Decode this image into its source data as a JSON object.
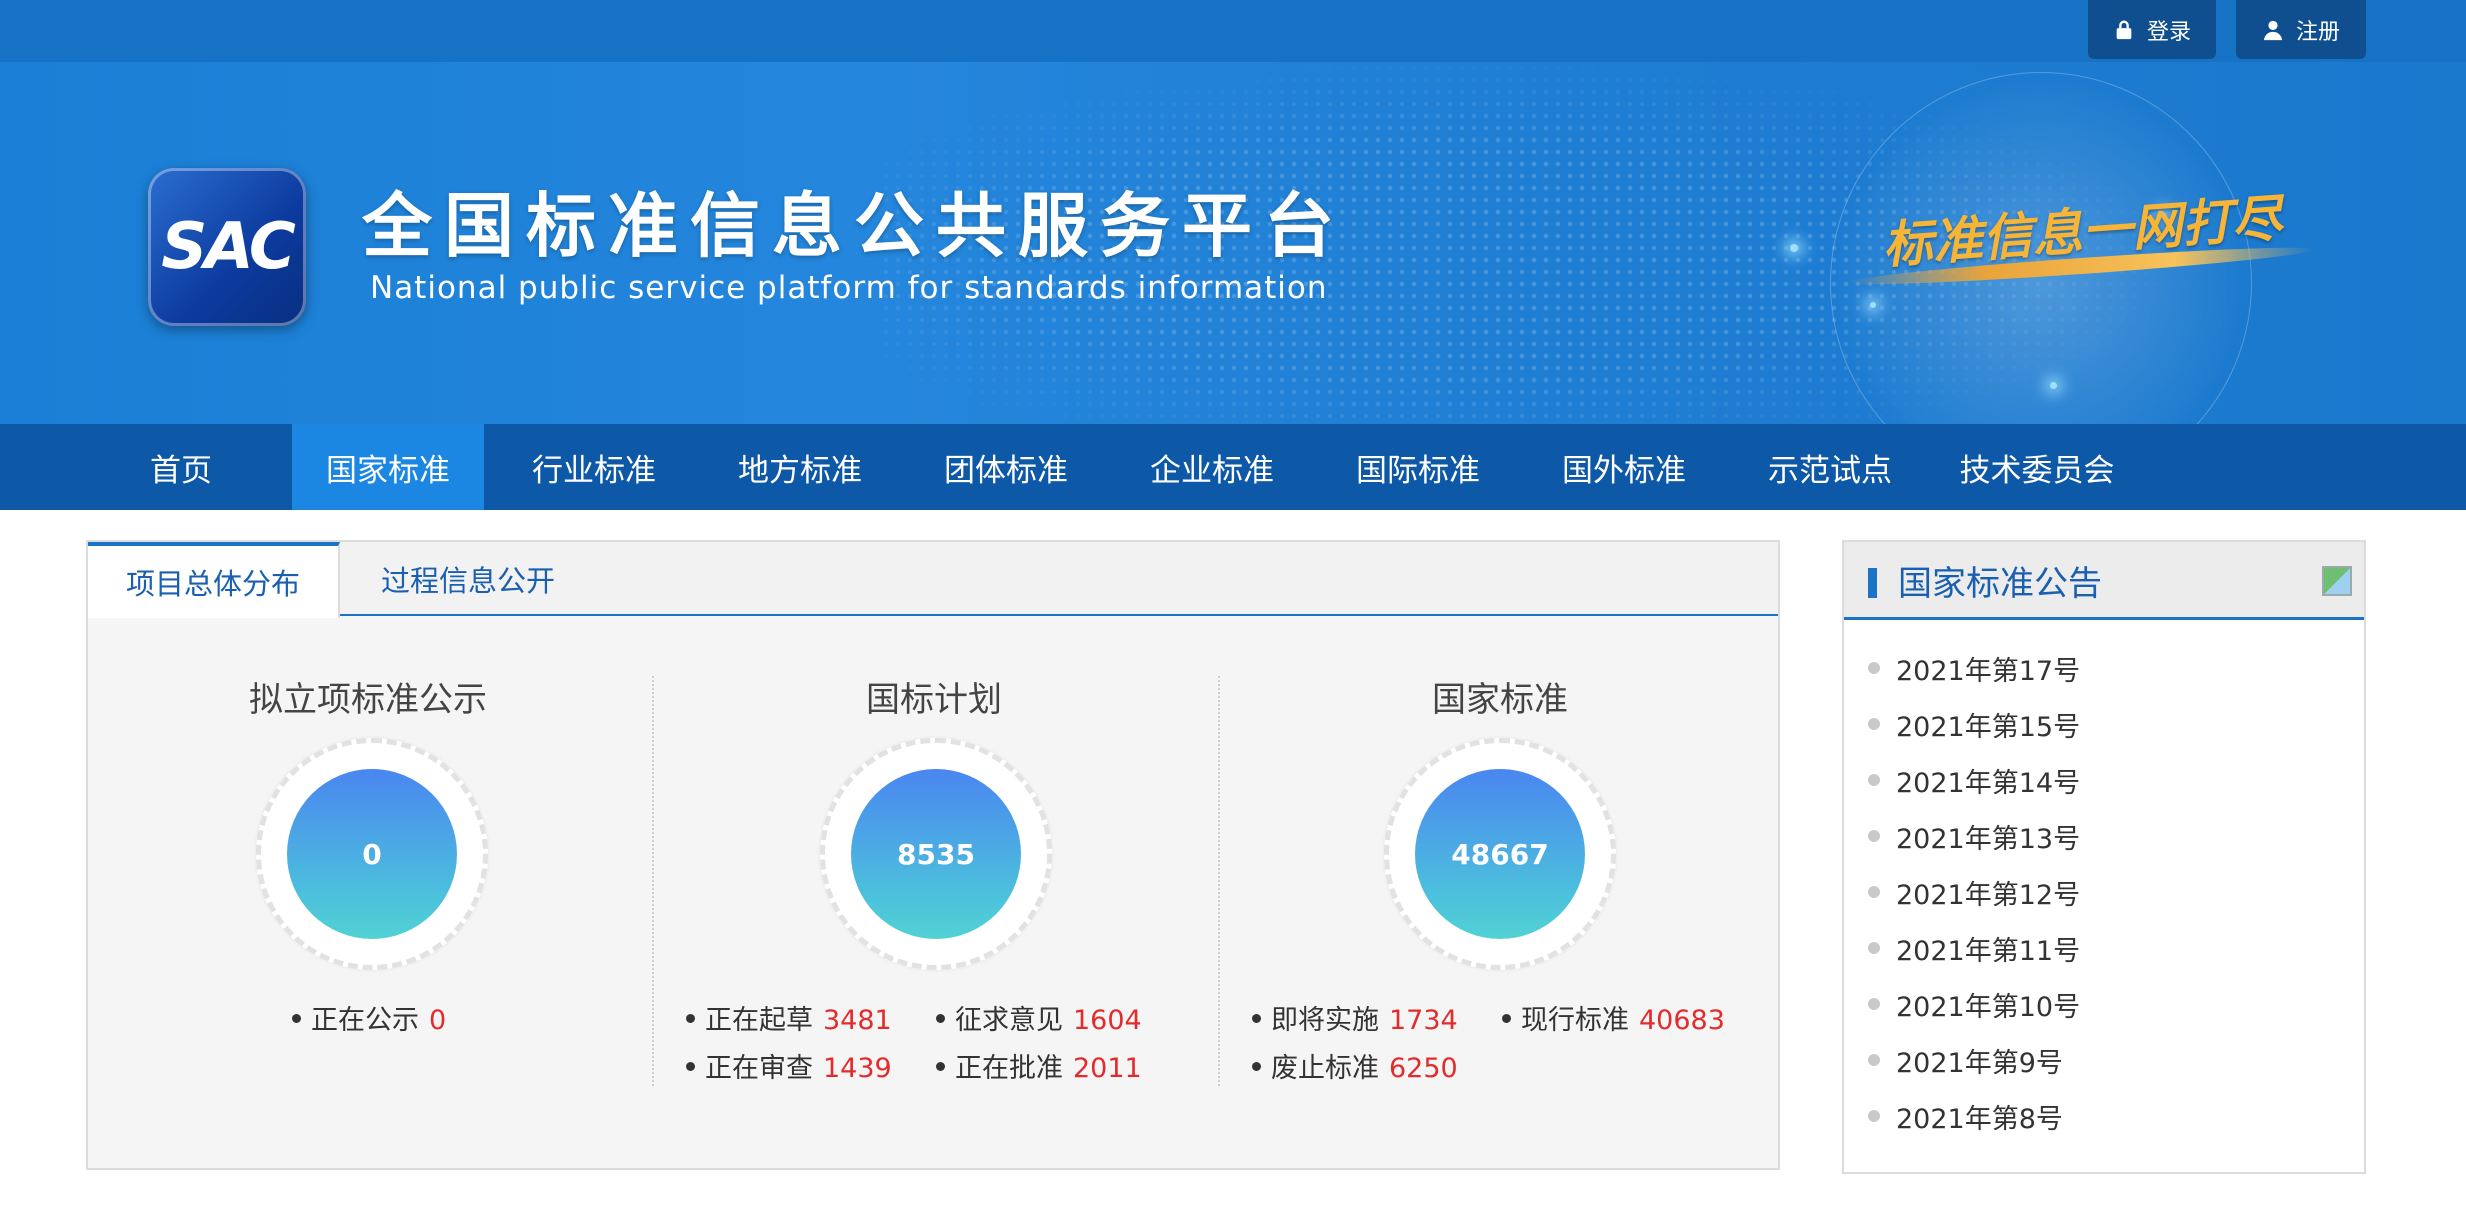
{
  "topbar": {
    "login_label": "登录",
    "register_label": "注册"
  },
  "banner": {
    "logo_text": "SAC",
    "title": "全国标准信息公共服务平台",
    "subtitle": "National public service platform  for standards information",
    "slogan": "标准信息一网打尽"
  },
  "nav": {
    "items": [
      {
        "label": "首页"
      },
      {
        "label": "国家标准"
      },
      {
        "label": "行业标准"
      },
      {
        "label": "地方标准"
      },
      {
        "label": "团体标准"
      },
      {
        "label": "企业标准"
      },
      {
        "label": "国际标准"
      },
      {
        "label": "国外标准"
      },
      {
        "label": "示范试点"
      },
      {
        "label": "技术委员会"
      }
    ],
    "active_index": 1
  },
  "main": {
    "tabs": [
      {
        "label": "项目总体分布"
      },
      {
        "label": "过程信息公开"
      }
    ],
    "columns": [
      {
        "title": "拟立项标准公示",
        "total": "0",
        "stats": [
          {
            "label": "正在公示",
            "value": "0"
          }
        ]
      },
      {
        "title": "国标计划",
        "total": "8535",
        "stats": [
          {
            "label": "正在起草",
            "value": "3481"
          },
          {
            "label": "征求意见",
            "value": "1604"
          },
          {
            "label": "正在审查",
            "value": "1439"
          },
          {
            "label": "正在批准",
            "value": "2011"
          }
        ]
      },
      {
        "title": "国家标准",
        "total": "48667",
        "stats": [
          {
            "label": "即将实施",
            "value": "1734"
          },
          {
            "label": "现行标准",
            "value": "40683"
          },
          {
            "label": "废止标准",
            "value": "6250"
          }
        ]
      }
    ]
  },
  "side": {
    "title": "国家标准公告",
    "items": [
      {
        "label": "2021年第17号"
      },
      {
        "label": "2021年第15号"
      },
      {
        "label": "2021年第14号"
      },
      {
        "label": "2021年第13号"
      },
      {
        "label": "2021年第12号"
      },
      {
        "label": "2021年第11号"
      },
      {
        "label": "2021年第10号"
      },
      {
        "label": "2021年第9号"
      },
      {
        "label": "2021年第8号"
      }
    ]
  },
  "colors": {
    "accent": "#1b73c8",
    "nav_bg": "#0e58a8",
    "nav_active": "#1c86e3",
    "number_red": "#e32b2b"
  }
}
